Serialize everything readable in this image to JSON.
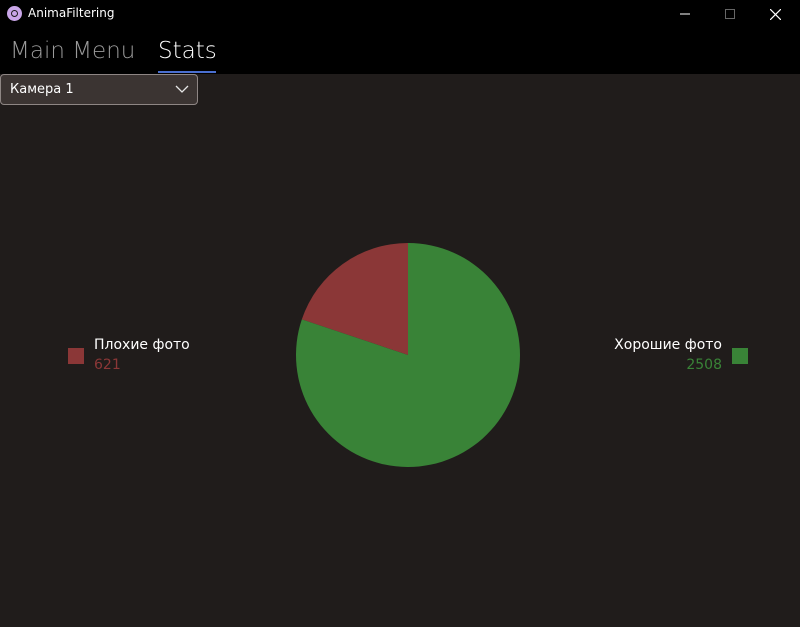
{
  "window": {
    "title": "AnimaFiltering"
  },
  "tabs": [
    {
      "label": "Main Menu",
      "selected": false
    },
    {
      "label": "Stats",
      "selected": true
    }
  ],
  "camera_select": {
    "value": "Камера 1"
  },
  "colors": {
    "bad": "#8b3737",
    "good": "#398337",
    "accent": "#4a6fd0"
  },
  "chart_data": {
    "type": "pie",
    "categories": [
      "Плохие фото",
      "Хорошие фото"
    ],
    "values": [
      621,
      2508
    ],
    "colors": [
      "#8b3737",
      "#398337"
    ]
  },
  "legend": {
    "bad": {
      "label": "Плохие фото",
      "value": "621"
    },
    "good": {
      "label": "Хорошие фото",
      "value": "2508"
    }
  }
}
